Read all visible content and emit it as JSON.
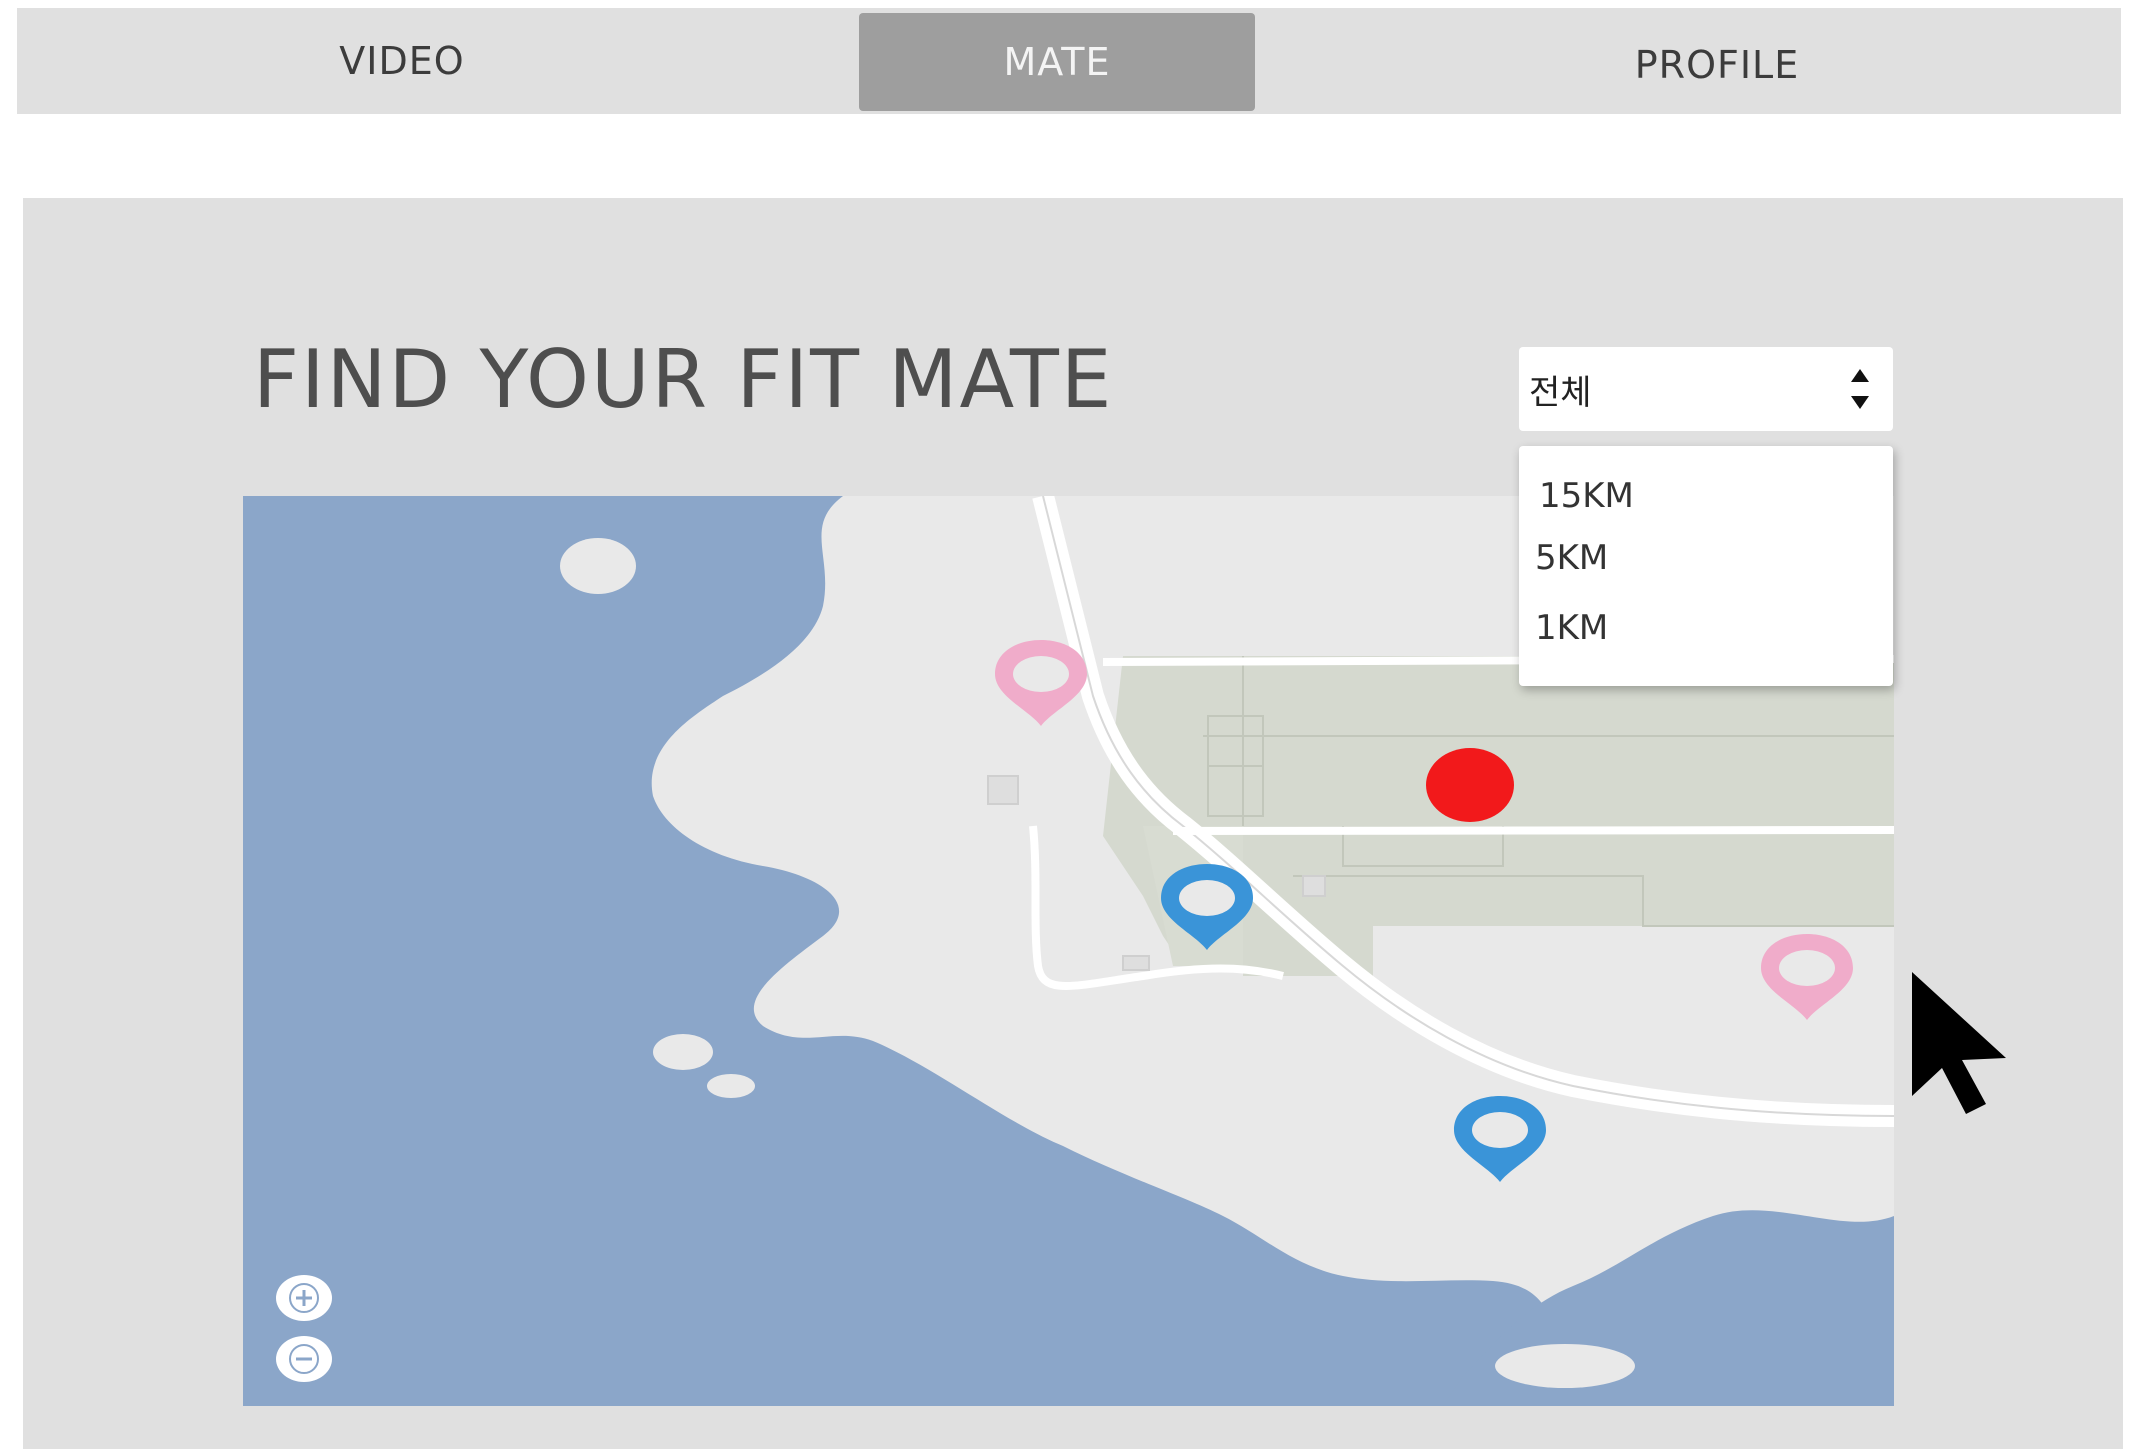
{
  "nav": {
    "tabs": [
      {
        "label": "VIDEO",
        "active": false
      },
      {
        "label": "MATE",
        "active": true
      },
      {
        "label": "PROFILE",
        "active": false
      }
    ]
  },
  "main": {
    "title": "FIND YOUR FIT MATE",
    "distance_filter": {
      "selected": "전체",
      "options": [
        "15KM",
        "5KM",
        "1KM"
      ]
    }
  },
  "map": {
    "colors": {
      "water": "#8ba6c9",
      "land": "#e9e9e9",
      "building": "#d5d9cf",
      "road": "#ffffff",
      "pin_pink": "#f0acca",
      "pin_blue": "#3a94d8",
      "current_location": "#f2191b"
    },
    "markers": [
      {
        "icon": "map-pin-icon",
        "color": "pink"
      },
      {
        "icon": "map-pin-icon",
        "color": "blue"
      },
      {
        "icon": "map-pin-icon",
        "color": "blue"
      },
      {
        "icon": "map-pin-icon",
        "color": "pink"
      }
    ],
    "zoom_controls": [
      "zoom-in-icon",
      "zoom-out-icon"
    ]
  }
}
